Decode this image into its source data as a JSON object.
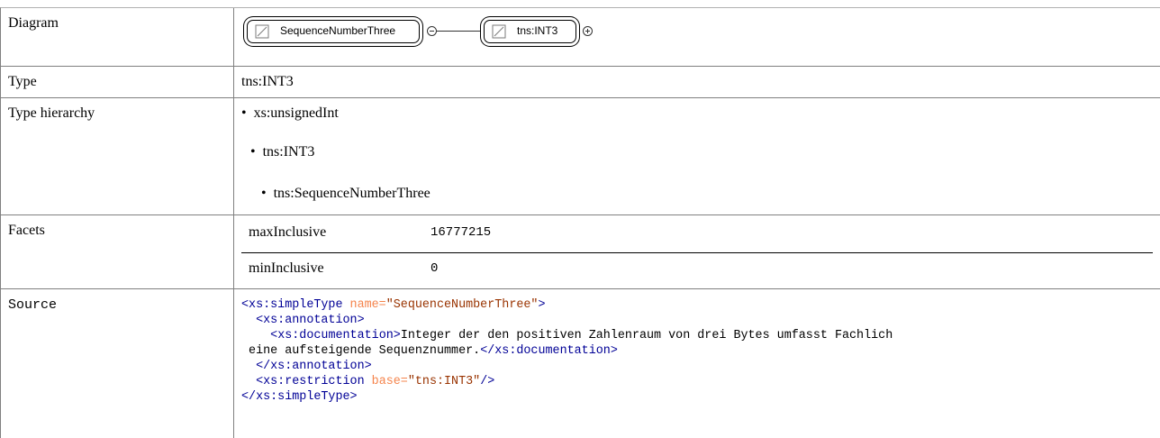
{
  "rows": {
    "diagram": {
      "label": "Diagram"
    },
    "type": {
      "label": "Type",
      "value": "tns:INT3"
    },
    "hierarchy": {
      "label": "Type hierarchy",
      "items": [
        "xs:unsignedInt",
        "tns:INT3",
        "tns:SequenceNumberThree"
      ]
    },
    "facets": {
      "label": "Facets",
      "items": [
        {
          "name": "maxInclusive",
          "value": "16777215"
        },
        {
          "name": "minInclusive",
          "value": "0"
        }
      ]
    },
    "source": {
      "label": "Source"
    }
  },
  "diagram": {
    "node1": "SequenceNumberThree",
    "node2": "tns:INT3"
  },
  "source": {
    "l1_open": "<xs:simpleType",
    "l1_attr": " name=",
    "l1_val": "\"SequenceNumberThree\"",
    "l1_close": ">",
    "l2": "  <xs:annotation>",
    "l3_indent": "    ",
    "l3_open": "<xs:documentation>",
    "l3_text": "Integer der den positiven Zahlenraum von drei Bytes umfasst Fachlich",
    "l4_text": " eine aufsteigende Sequenznummer.",
    "l4_close": "</xs:documentation>",
    "l5": "  </xs:annotation>",
    "l6_indent": "  ",
    "l6_open": "<xs:restriction",
    "l6_attr": " base=",
    "l6_val": "\"tns:INT3\"",
    "l6_close": "/>",
    "l7": "</xs:simpleType>"
  },
  "colors": {
    "tag": "#000096",
    "attribute": "#f5844c",
    "value": "#993300",
    "border": "#808080"
  }
}
